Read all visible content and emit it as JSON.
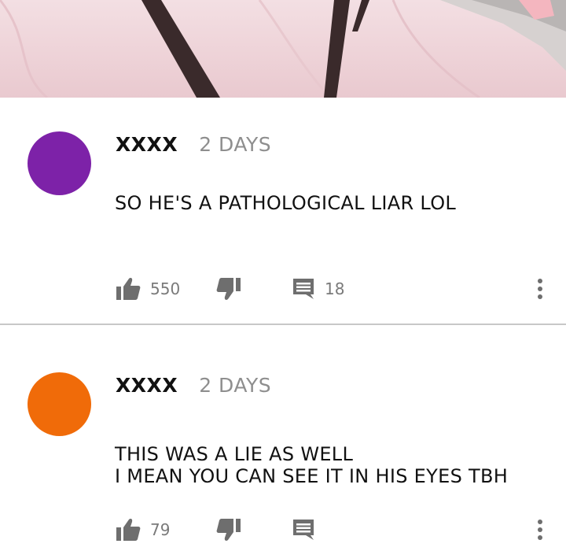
{
  "comments": [
    {
      "username": "XXXX",
      "time": "2 DAYS",
      "avatar_color": "#7d22a8",
      "lines": [
        "SO HE'S A PATHOLOGICAL LIAR LOL"
      ],
      "likes": "550",
      "replies": "18"
    },
    {
      "username": "XXXX",
      "time": "2 DAYS",
      "avatar_color": "#f06b09",
      "lines": [
        "THIS WAS A LIE AS WELL",
        "I MEAN YOU CAN SEE IT IN HIS EYES TBH"
      ],
      "likes": "79",
      "replies": ""
    }
  ],
  "icons": {
    "like": "thumbs-up-icon",
    "dislike": "thumbs-down-icon",
    "reply": "comment-icon",
    "more": "more-vertical-icon"
  },
  "colors": {
    "icon": "#6e6e6e",
    "divider": "#c8c8c8"
  }
}
